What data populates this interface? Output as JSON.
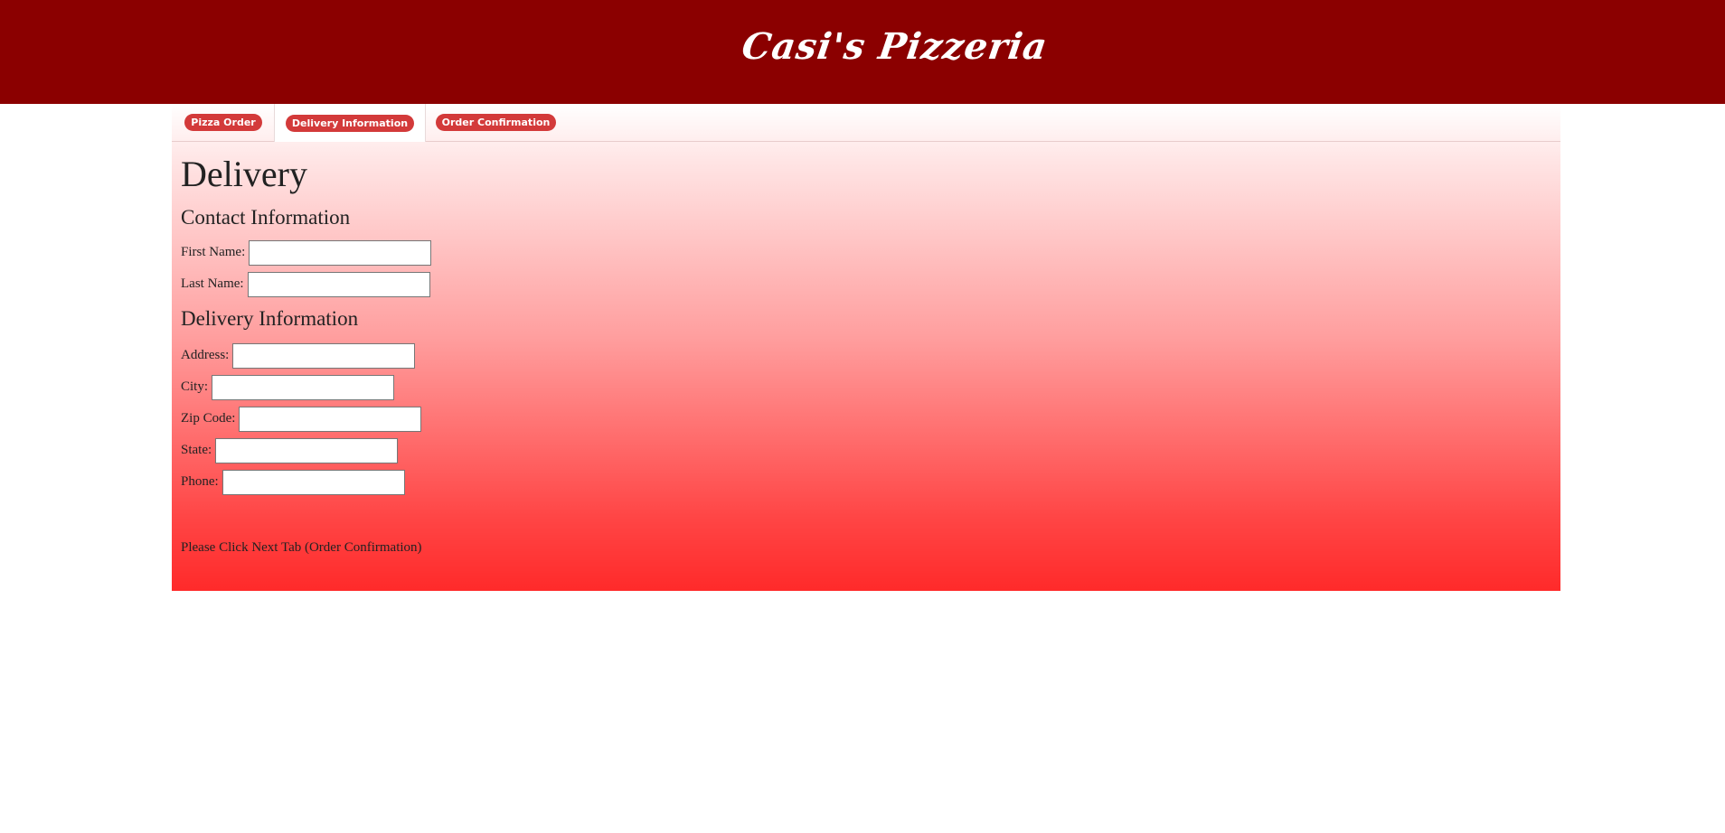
{
  "header": {
    "brand": "Casi's Pizzeria"
  },
  "tabs": [
    {
      "label": "Pizza Order",
      "active": false
    },
    {
      "label": "Delivery Information",
      "active": true
    },
    {
      "label": "Order Confirmation",
      "active": false
    }
  ],
  "page": {
    "title": "Delivery",
    "contact_heading": "Contact Information",
    "delivery_heading": "Delivery Information",
    "note": "Please Click Next Tab (Order Confirmation)"
  },
  "fields": {
    "first_name": {
      "label": "First Name:",
      "value": ""
    },
    "last_name": {
      "label": "Last Name:",
      "value": ""
    },
    "address": {
      "label": "Address:",
      "value": ""
    },
    "city": {
      "label": "City:",
      "value": ""
    },
    "zip": {
      "label": "Zip Code:",
      "value": ""
    },
    "state": {
      "label": "State:",
      "value": ""
    },
    "phone": {
      "label": "Phone:",
      "value": ""
    }
  },
  "colors": {
    "header_bg": "#8b0000",
    "tab_pill": "#d33a3a",
    "gradient_bottom": "#ff2a2a"
  }
}
